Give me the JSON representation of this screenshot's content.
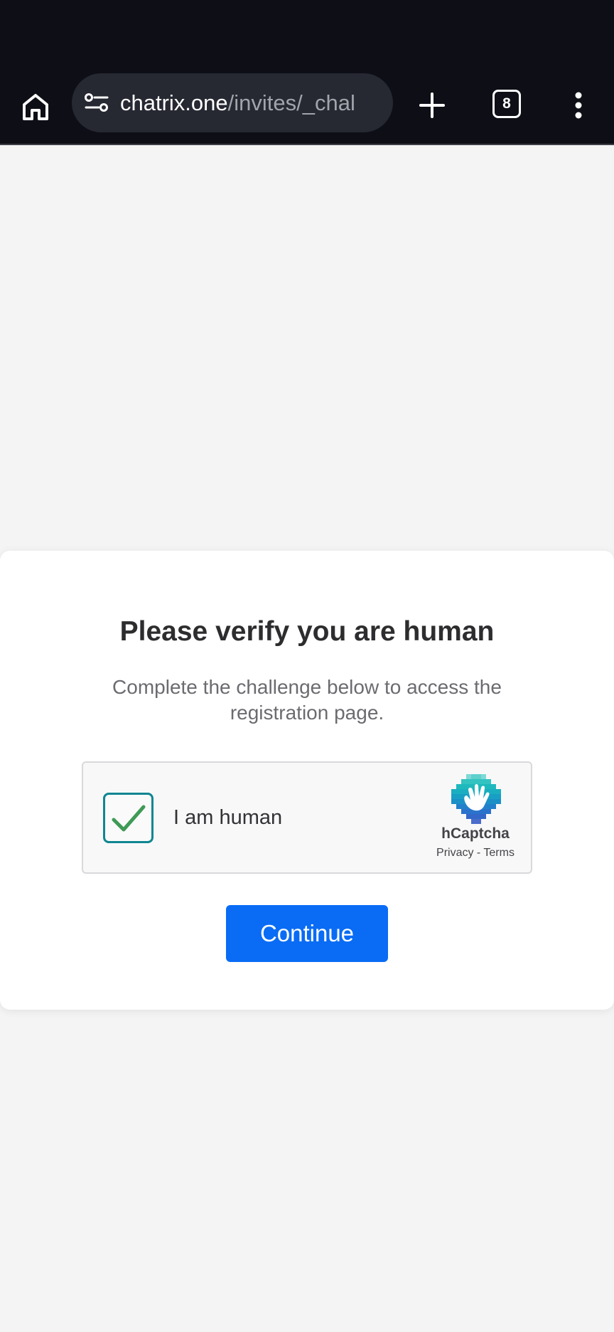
{
  "browser": {
    "url_host": "chatrix.one",
    "url_path": "/invites/_chal",
    "tab_count": "8",
    "icons": {
      "home": "home-icon",
      "site_settings": "tune-icon",
      "new_tab": "plus-icon",
      "menu": "more-vert-icon"
    }
  },
  "card": {
    "title": "Please verify you are human",
    "subtitle": "Complete the challenge below to access the registration page.",
    "captcha": {
      "label": "I am human",
      "checked": true,
      "brand": "hCaptcha",
      "privacy": "Privacy",
      "separator": " - ",
      "terms": "Terms"
    },
    "continue_label": "Continue"
  },
  "colors": {
    "accent": "#0a6cf5",
    "checkbox_border": "#0f8691",
    "checkmark": "#3f9a56",
    "toolbar_bg": "#0e0f16"
  }
}
